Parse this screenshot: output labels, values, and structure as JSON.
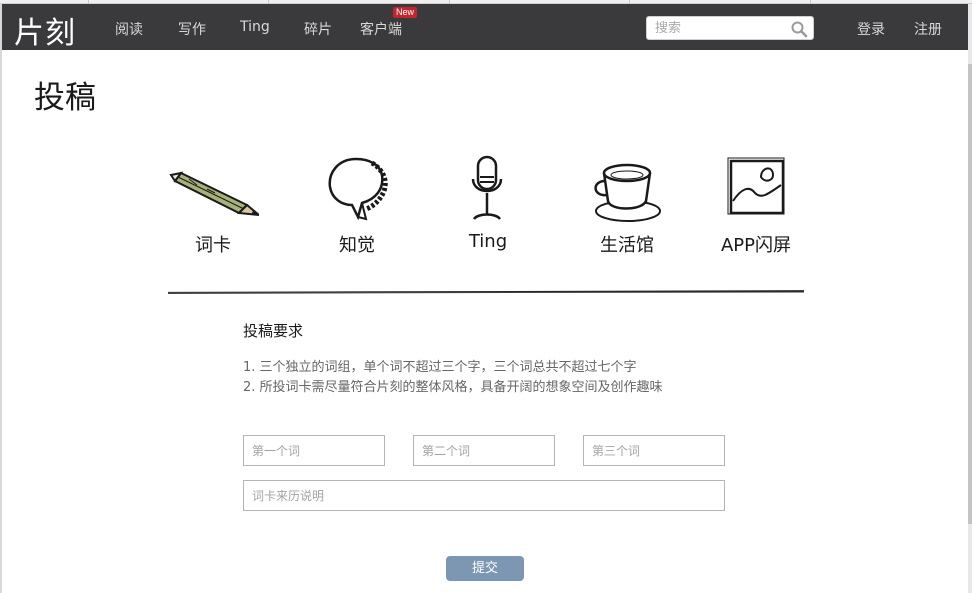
{
  "navbar": {
    "logo": "片刻",
    "links": [
      "阅读",
      "写作",
      "Ting",
      "碎片",
      "客户端"
    ],
    "new_badge": "New",
    "search": {
      "placeholder": "搜索"
    },
    "login": "登录",
    "register": "注册"
  },
  "page": {
    "title": "投稿"
  },
  "categories": [
    {
      "label": "词卡",
      "icon": "pencil-icon"
    },
    {
      "label": "知觉",
      "icon": "speech-bubble-icon"
    },
    {
      "label": "Ting",
      "icon": "microphone-icon"
    },
    {
      "label": "生活馆",
      "icon": "coffee-cup-icon"
    },
    {
      "label": "APP闪屏",
      "icon": "picture-frame-icon"
    }
  ],
  "requirements": {
    "title": "投稿要求",
    "items": [
      "1. 三个独立的词组，单个词不超过三个字，三个词总共不超过七个字",
      "2. 所投词卡需尽量符合片刻的整体风格，具备开阔的想象空间及创作趣味"
    ]
  },
  "form": {
    "word1_placeholder": "第一个词",
    "word2_placeholder": "第二个词",
    "word3_placeholder": "第三个词",
    "origin_placeholder": "词卡来历说明",
    "submit_label": "提交"
  },
  "colors": {
    "navbar_bg": "#3a3a3c",
    "submit_bg": "#7d97b3",
    "badge_bg": "#c0262d"
  }
}
